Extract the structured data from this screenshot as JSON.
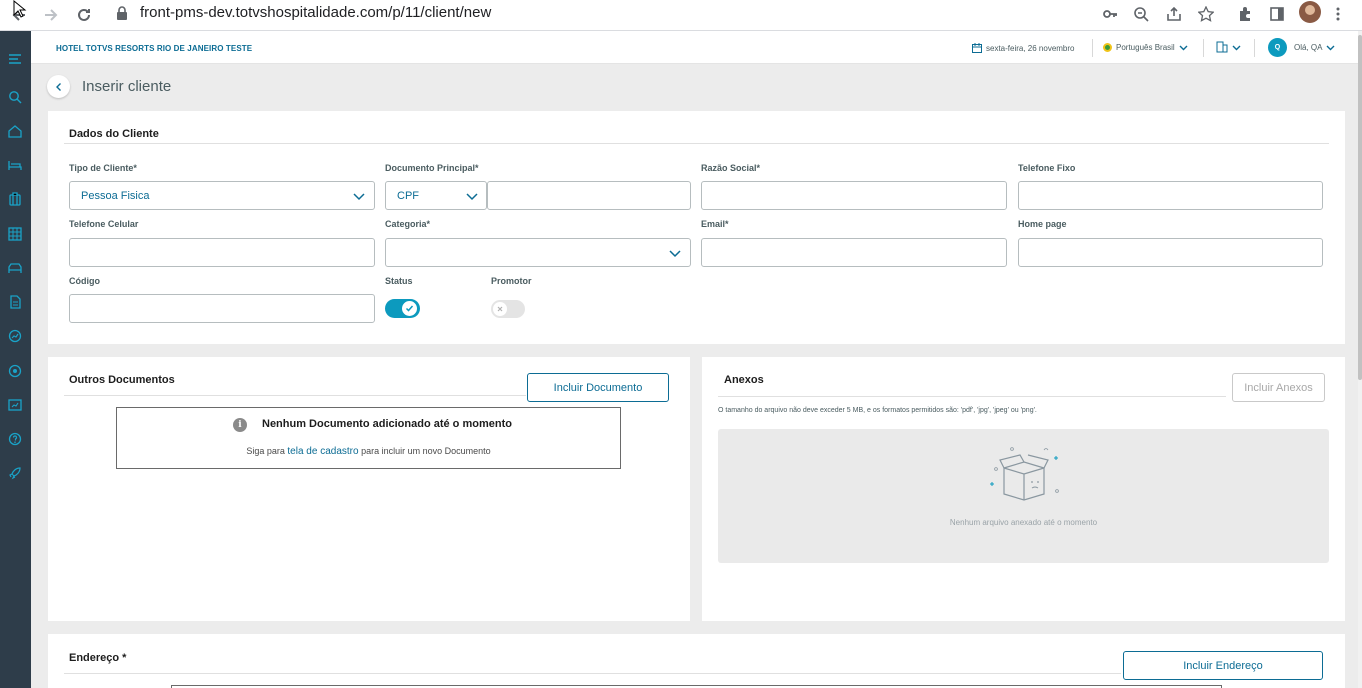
{
  "browser": {
    "url": "front-pms-dev.totvshospitalidade.com/p/11/client/new"
  },
  "topbar": {
    "hotel_name": "HOTEL TOTVS RESORTS RIO DE JANEIRO TESTE",
    "date": "sexta-feira, 26 novembro",
    "language": "Português Brasil",
    "user_initial": "Q",
    "greeting": "Olá, QA"
  },
  "page": {
    "title": "Inserir cliente"
  },
  "client_form": {
    "section_title": "Dados do Cliente",
    "tipo_cliente_label": "Tipo de Cliente*",
    "tipo_cliente_value": "Pessoa Fisica",
    "documento_label": "Documento Principal*",
    "documento_type": "CPF",
    "razao_label": "Razão Social*",
    "telefone_fixo_label": "Telefone Fixo",
    "telefone_celular_label": "Telefone Celular",
    "categoria_label": "Categoria*",
    "email_label": "Email*",
    "homepage_label": "Home page",
    "codigo_label": "Código",
    "status_label": "Status",
    "promotor_label": "Promotor"
  },
  "outros_documentos": {
    "title": "Outros Documentos",
    "add_button": "Incluir Documento",
    "empty_title": "Nenhum Documento adicionado até o momento",
    "empty_prefix": "Siga para",
    "empty_link": "tela de cadastro",
    "empty_suffix": "para incluir um novo Documento"
  },
  "anexos": {
    "title": "Anexos",
    "add_button": "Incluir Anexos",
    "hint": "O tamanho do arquivo não deve exceder 5 MB, e os formatos permitidos são: 'pdf', 'jpg', 'jpeg' ou 'png'.",
    "empty_text": "Nenhum arquivo anexado até o momento"
  },
  "endereco": {
    "title": "Endereço *",
    "add_button": "Incluir Endereço"
  },
  "colors": {
    "primary": "#0c6c94",
    "accent": "#0c9abe",
    "sidebar": "#2e3d4a"
  }
}
